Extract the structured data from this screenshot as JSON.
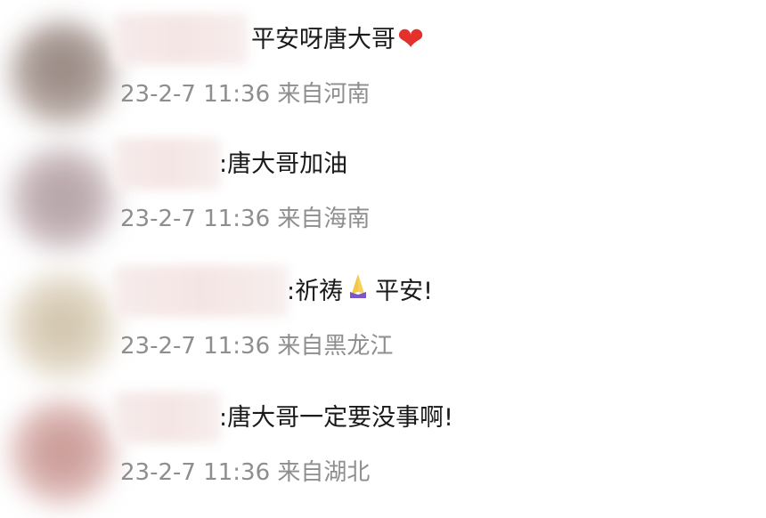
{
  "comments": [
    {
      "text": "平安呀唐大哥",
      "emoji": "heart-icon",
      "meta": "23-2-7 11:36 来自河南",
      "accent": "#e4312b"
    },
    {
      "text": ":唐大哥加油",
      "meta": "23-2-7 11:36 来自海南"
    },
    {
      "text_before": ":祈祷",
      "emoji": "praying-hands-icon",
      "text_after": "平安!",
      "meta": "23-2-7 11:36 来自黑龙江"
    },
    {
      "text": ":唐大哥一定要没事啊!",
      "meta": "23-2-7 11:36 来自湖北"
    }
  ]
}
